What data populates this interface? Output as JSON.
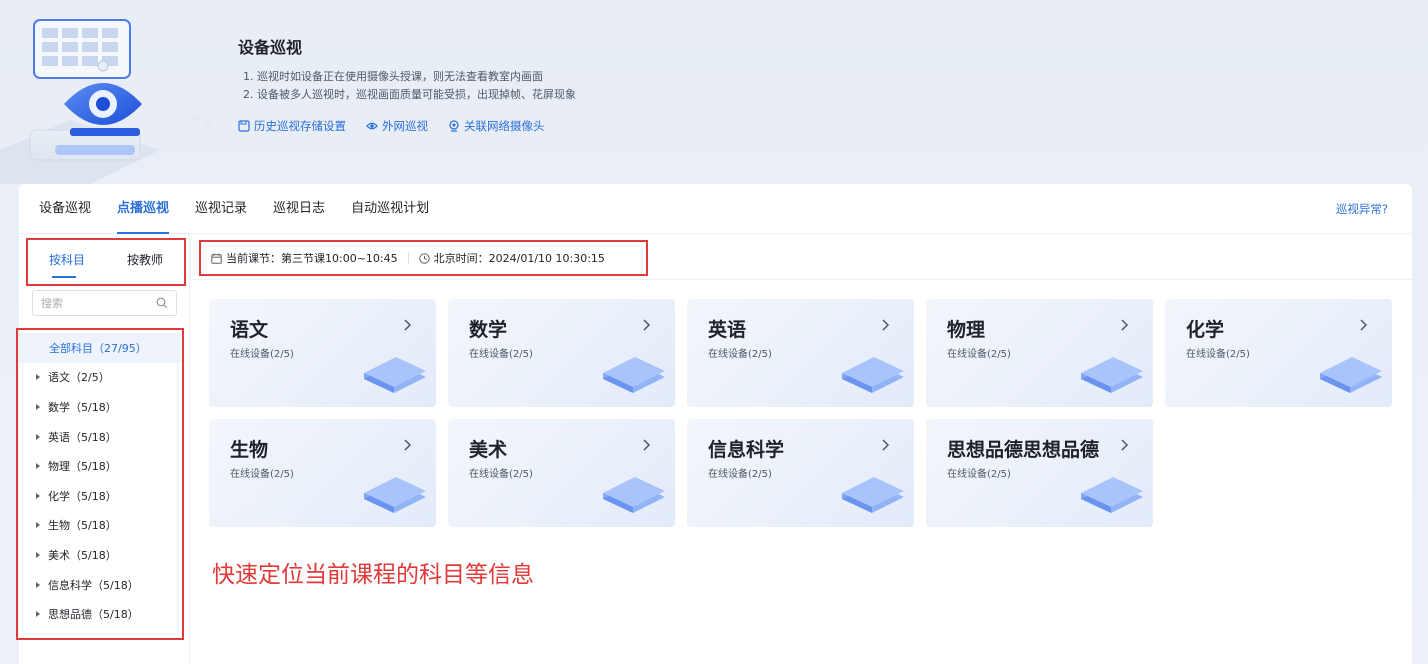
{
  "banner": {
    "title": "设备巡视",
    "tips": [
      "1. 巡视时如设备正在使用摄像头授课，则无法查看教室内画面",
      "2. 设备被多人巡视时，巡视画面质量可能受损，出现掉帧、花屏现象"
    ],
    "links": [
      {
        "label": "历史巡视存储设置",
        "icon": "save-icon"
      },
      {
        "label": "外网巡视",
        "icon": "eye-icon"
      },
      {
        "label": "关联网络摄像头",
        "icon": "camera-icon"
      }
    ]
  },
  "tabs": [
    "设备巡视",
    "点播巡视",
    "巡视记录",
    "巡视日志",
    "自动巡视计划"
  ],
  "active_tab": "点播巡视",
  "abnormal_link": "巡视异常?",
  "sidebar": {
    "subtabs": [
      "按科目",
      "按教师"
    ],
    "active_subtab": "按科目",
    "search_placeholder": "搜索",
    "items": [
      "全部科目（27/95）",
      "语文（2/5）",
      "数学（5/18）",
      "英语（5/18）",
      "物理（5/18）",
      "化学（5/18）",
      "生物（5/18）",
      "美术（5/18）",
      "信息科学（5/18）",
      "思想品德（5/18）"
    ]
  },
  "infobar": {
    "current_lesson": "当前课节：第三节课10:00~10:45",
    "beijing_time": "北京时间：2024/01/10 10:30:15"
  },
  "subjects": [
    {
      "name": "语文",
      "online": "在线设备(2/5)"
    },
    {
      "name": "数学",
      "online": "在线设备(2/5)"
    },
    {
      "name": "英语",
      "online": "在线设备(2/5)"
    },
    {
      "name": "物理",
      "online": "在线设备(2/5)"
    },
    {
      "name": "化学",
      "online": "在线设备(2/5)"
    },
    {
      "name": "生物",
      "online": "在线设备(2/5)"
    },
    {
      "name": "美术",
      "online": "在线设备(2/5)"
    },
    {
      "name": "信息科学",
      "online": "在线设备(2/5)"
    },
    {
      "name": "思想品德思想品德",
      "online": "在线设备(2/5)"
    }
  ],
  "annotation": "快速定位当前课程的科目等信息",
  "colors": {
    "accent": "#2b6fdb",
    "highlight_red": "#e03a3a"
  }
}
